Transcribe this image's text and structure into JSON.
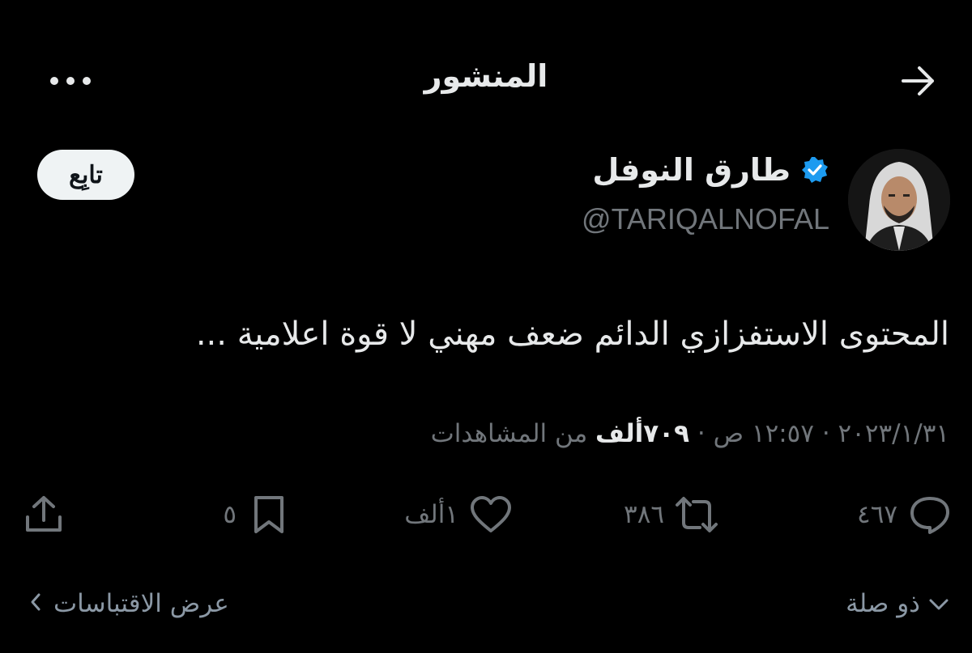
{
  "header": {
    "title": "المنشور",
    "back_icon": "arrow-right-icon",
    "more_icon": "more-horizontal-icon"
  },
  "author": {
    "display_name": "طارق النوفل",
    "handle": "@TARIQALNOFAL",
    "verified_icon": "verified-badge-icon",
    "verified_color": "#1d9bf0",
    "follow_label": "تابِع"
  },
  "post": {
    "text": "المحتوى الاستفزازي الدائم ضعف مهني لا قوة اعلامية ..."
  },
  "meta": {
    "date": "٢٠٢٣/١/٣١",
    "separator": "·",
    "time": "١٢:٥٧ ص",
    "views_count": "٧٠٩ألف",
    "views_label": "من المشاهدات"
  },
  "actions": {
    "replies": "٤٦٧",
    "reposts": "٣٨٦",
    "likes": "١ألف",
    "bookmarks": "٥"
  },
  "footer": {
    "related_label": "ذو صلة",
    "quotes_label": "عرض الاقتباسات"
  },
  "colors": {
    "background": "#000000",
    "text_primary": "#e7e9ea",
    "text_secondary": "#71767b",
    "accent": "#1d9bf0"
  }
}
